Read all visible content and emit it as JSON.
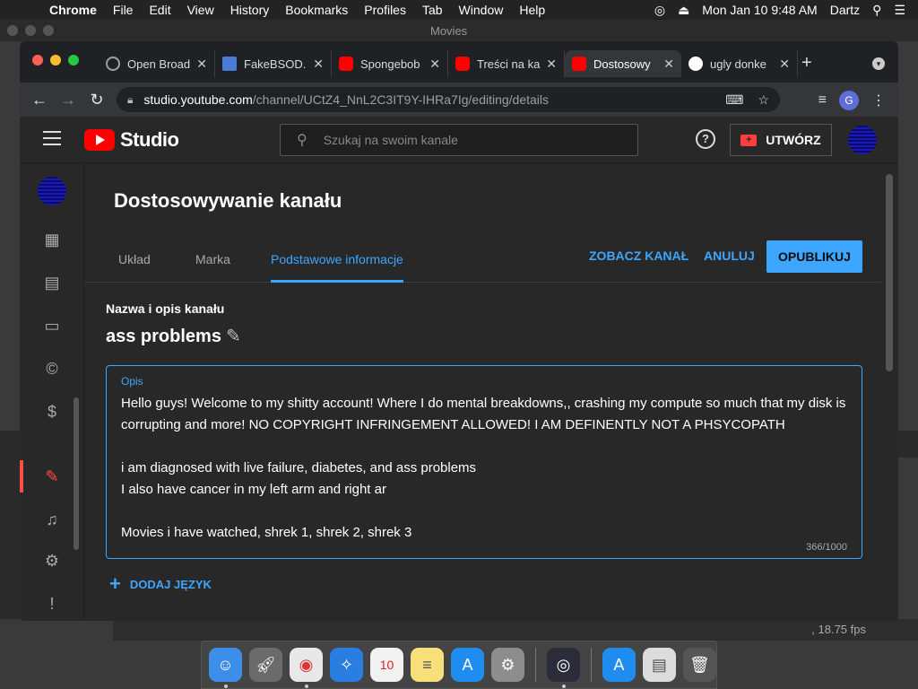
{
  "menubar": {
    "apple": "",
    "app": "Chrome",
    "items": [
      "File",
      "Edit",
      "View",
      "History",
      "Bookmarks",
      "Profiles",
      "Tab",
      "Window",
      "Help"
    ],
    "datetime": "Mon Jan 10  9:48 AM",
    "user": "Dartz"
  },
  "bgwindow": {
    "title": "Movies",
    "fps": ", 18.75 fps"
  },
  "tabs": [
    {
      "title": "Open Broad",
      "icon": "globe-icon",
      "color": "#9aa0a6"
    },
    {
      "title": "FakeBSOD.",
      "icon": "monitor-icon",
      "color": "#4a7bd6"
    },
    {
      "title": "Spongebob",
      "icon": "youtube-icon",
      "color": "#ff0000"
    },
    {
      "title": "Treści na ka",
      "icon": "youtube-icon",
      "color": "#ff0000"
    },
    {
      "title": "Dostosowy",
      "icon": "youtube-icon",
      "color": "#ff0000"
    },
    {
      "title": "ugly donke",
      "icon": "google-icon",
      "color": "#ffffff"
    }
  ],
  "omnibox": {
    "host": "studio.youtube.com",
    "path": "/channel/UCtZ4_NnL2C3IT9Y-IHRa7Ig/editing/details"
  },
  "profile_initial": "G",
  "yt": {
    "logo_text": "Studio",
    "search_placeholder": "Szukaj na swoim kanale",
    "create_label": "UTWÓRZ",
    "page_title": "Dostosowywanie kanału",
    "tabs": [
      "Układ",
      "Marka",
      "Podstawowe informacje"
    ],
    "view_channel": "ZOBACZ KANAŁ",
    "cancel": "ANULUJ",
    "publish": "OPUBLIKUJ",
    "section_header": "Nazwa i opis kanału",
    "channel_name": "ass problems",
    "desc_label": "Opis",
    "desc_lines": [
      "Hello guys! Welcome to my shitty account! Where I do mental breakdowns,, crashing my compute so much that my disk is",
      "corrupting and more! NO COPYRIGHT INFRINGEMENT ALLOWED! I AM DEFINENTLY NOT A  PHSYCOPATH",
      "",
      "i am diagnosed with live failure, diabetes, and ass problems",
      "I also have cancer in my left arm and right ar",
      "",
      "Movies i have watched, shrek 1, shrek 2, shrek 3"
    ],
    "char_count": "366/1000",
    "add_language": "DODAJ JĘZYK"
  }
}
